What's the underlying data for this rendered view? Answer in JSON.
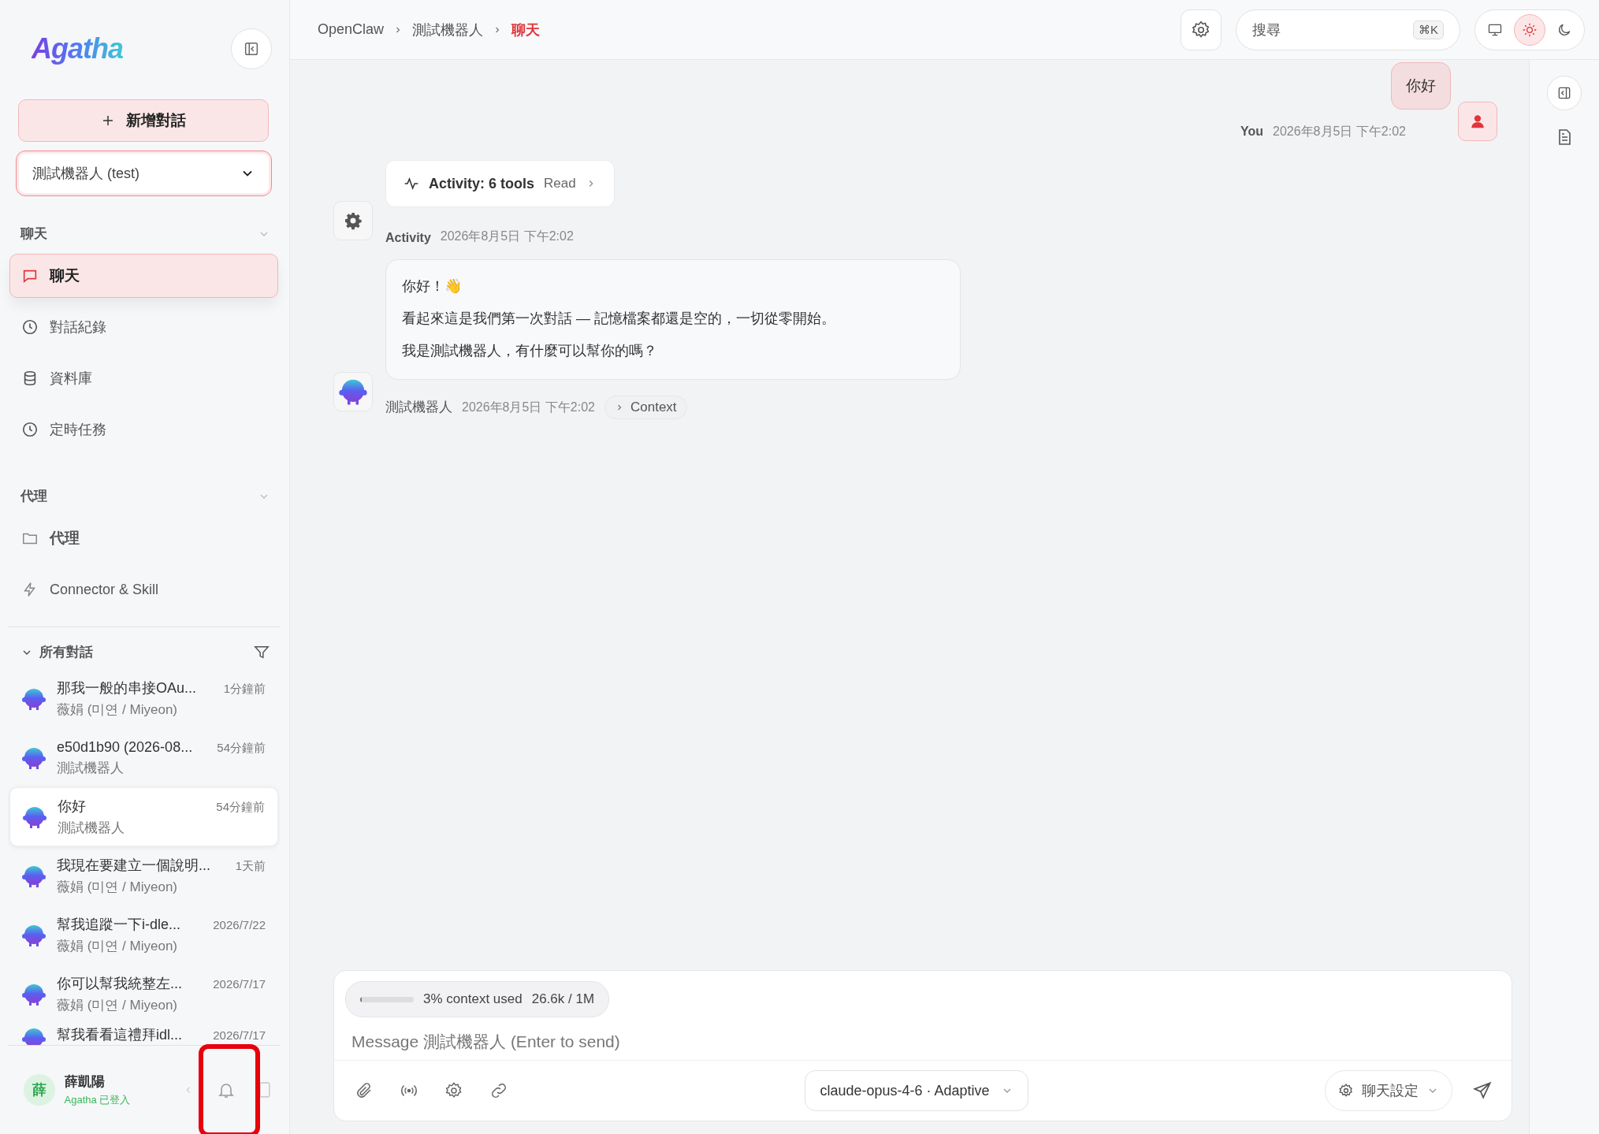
{
  "logo": "Agatha",
  "sidebar": {
    "new_chat": "新增對話",
    "agent_select": {
      "value": "測試機器人 (test)"
    },
    "sections": [
      {
        "title": "聊天",
        "items": [
          {
            "label": "聊天",
            "kind": "chat",
            "selected": true
          },
          {
            "label": "對話紀錄",
            "kind": "clock",
            "selected": false
          },
          {
            "label": "資料庫",
            "kind": "database",
            "selected": false
          },
          {
            "label": "定時任務",
            "kind": "clock",
            "selected": false
          }
        ]
      },
      {
        "title": "代理",
        "items": [
          {
            "label": "代理",
            "kind": "folder",
            "selected": false
          },
          {
            "label": "Connector & Skill",
            "kind": "bolt",
            "selected": false
          }
        ]
      }
    ],
    "conversations": {
      "title": "所有對話",
      "items": [
        {
          "title": "那我一般的串接OAu...",
          "subtitle": "薇娟 (미연 / Miyeon)",
          "time": "1分鐘前",
          "selected": false
        },
        {
          "title": "e50d1b90 (2026-08...",
          "subtitle": "測試機器人",
          "time": "54分鐘前",
          "selected": false
        },
        {
          "title": "你好",
          "subtitle": "測試機器人",
          "time": "54分鐘前",
          "selected": true
        },
        {
          "title": "我現在要建立一個說明...",
          "subtitle": "薇娟 (미연 / Miyeon)",
          "time": "1天前",
          "selected": false
        },
        {
          "title": "幫我追蹤一下i-dle...",
          "subtitle": "薇娟 (미연 / Miyeon)",
          "time": "2026/7/22",
          "selected": false
        },
        {
          "title": "你可以幫我統整左...",
          "subtitle": "薇娟 (미연 / Miyeon)",
          "time": "2026/7/17",
          "selected": false
        },
        {
          "title": "幫我看看這禮拜idl...",
          "time": "2026/7/17",
          "selected": false
        }
      ]
    },
    "user": {
      "initial": "薛",
      "name": "薛凱陽",
      "status": "Agatha 已登入"
    }
  },
  "breadcrumb": [
    {
      "label": "OpenClaw",
      "selected": false
    },
    {
      "label": "測試機器人",
      "selected": false
    },
    {
      "label": "聊天",
      "selected": true
    }
  ],
  "search": {
    "placeholder": "搜尋",
    "shortcut": "⌘K"
  },
  "theme_modes": [
    {
      "kind": "monitor",
      "selected": false
    },
    {
      "kind": "sun",
      "selected": true
    },
    {
      "kind": "moon",
      "selected": false
    }
  ],
  "messages": [
    {
      "kind": "user",
      "text": "你好",
      "author": "You",
      "time": "2026年8月5日 下午2:02"
    },
    {
      "kind": "activity",
      "title": "Activity: 6 tools",
      "detail": "Read",
      "author": "Activity",
      "time": "2026年8月5日 下午2:02"
    },
    {
      "kind": "bot",
      "paragraphs": [
        "你好！👋",
        "看起來這是我們第一次對話 — 記憶檔案都還是空的，一切從零開始。",
        "我是測試機器人，有什麼可以幫你的嗎？"
      ],
      "author": "測試機器人",
      "time": "2026年8月5日 下午2:02",
      "context": "Context"
    }
  ],
  "composer": {
    "context_meter": {
      "level": 0.03,
      "label": "3% context used",
      "tokens": "26.6k / 1M"
    },
    "placeholder": "Message 測試機器人 (Enter to send)",
    "model": "claude-opus-4-6 · Adaptive",
    "settings": "聊天設定"
  }
}
